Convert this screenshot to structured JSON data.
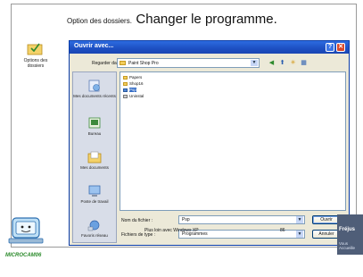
{
  "slide": {
    "title_small": "Option des dossiers.",
    "title_big": "Changer le programme.",
    "left_label": "Options des dossiers",
    "footer_center": "Plus loin avec Windows XP",
    "page_number": "86",
    "brand": "MICROCAM06"
  },
  "dialog": {
    "title": "Ouvrir avec...",
    "help_button": "?",
    "close_button": "✕",
    "lookin_label": "Regarder dans :",
    "lookin_value": "Paint Shop Pro",
    "toolbar": [
      "◀",
      "⬆",
      "✳",
      "▦"
    ],
    "places": [
      {
        "label": "Mes documents récents"
      },
      {
        "label": "Bureau"
      },
      {
        "label": "Mes documents"
      },
      {
        "label": "Poste de travail"
      },
      {
        "label": "Favoris réseau"
      }
    ],
    "files": [
      {
        "name": "Papers",
        "selected": false
      },
      {
        "name": "Shop16",
        "selected": false
      },
      {
        "name": "Psp",
        "selected": true
      },
      {
        "name": "Uninstal",
        "selected": false
      }
    ],
    "filename_label": "Nom du fichier :",
    "filename_value": "Psp",
    "filetype_label": "Fichiers de type :",
    "filetype_value": "Programmes",
    "open_button": "Ouvrir",
    "cancel_button": "Annuler"
  },
  "side_panel": {
    "line1": "Fréjus",
    "line2": "Vous Accueille"
  },
  "colors": {
    "titlebar": "#1d4fc2",
    "close": "#d9482a",
    "brand_green": "#2a8a2a",
    "selection": "#316ac5"
  }
}
